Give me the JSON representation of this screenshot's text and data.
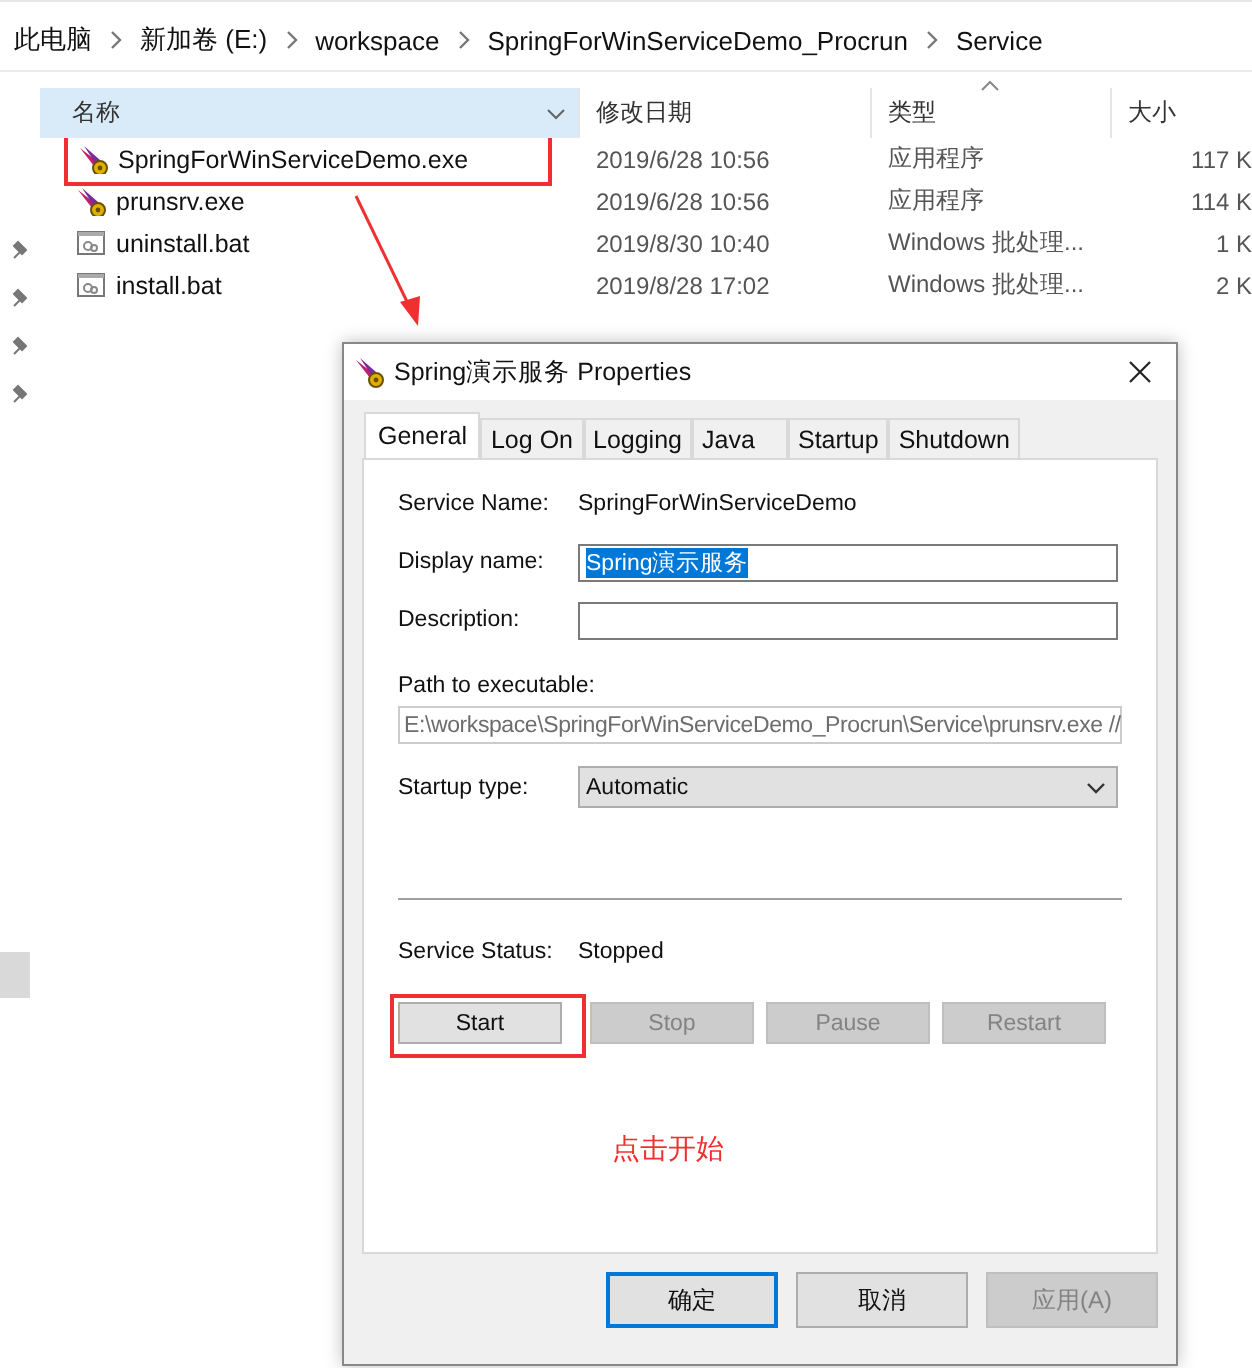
{
  "breadcrumb": [
    "此电脑",
    "新加卷 (E:)",
    "workspace",
    "SpringForWinServiceDemo_Procrun",
    "Service"
  ],
  "file_list": {
    "columns": [
      {
        "label": "名称",
        "selected": true
      },
      {
        "label": "修改日期",
        "selected": false
      },
      {
        "label": "类型",
        "selected": false
      },
      {
        "label": "大小",
        "selected": false
      }
    ],
    "rows": [
      {
        "kind": "exe",
        "name": "SpringForWinServiceDemo.exe",
        "date": "2019/6/28 10:56",
        "type": "应用程序",
        "size": "117 K",
        "highlighted": true
      },
      {
        "kind": "exe",
        "name": "prunsrv.exe",
        "date": "2019/6/28 10:56",
        "type": "应用程序",
        "size": "114 K",
        "highlighted": false
      },
      {
        "kind": "bat",
        "name": "uninstall.bat",
        "date": "2019/8/30 10:40",
        "type": "Windows 批处理...",
        "size": "1 K",
        "highlighted": false
      },
      {
        "kind": "bat",
        "name": "install.bat",
        "date": "2019/8/28 17:02",
        "type": "Windows 批处理...",
        "size": "2 K",
        "highlighted": false
      }
    ]
  },
  "dialog": {
    "title": "Spring演示服务 Properties",
    "tabs": [
      {
        "label": "General",
        "selected": true
      },
      {
        "label": "Log On",
        "selected": false
      },
      {
        "label": "Logging",
        "selected": false
      },
      {
        "label": "Java",
        "selected": false
      },
      {
        "label": "Startup",
        "selected": false
      },
      {
        "label": "Shutdown",
        "selected": false
      }
    ],
    "service_name": {
      "label": "Service Name:",
      "value": "SpringForWinServiceDemo"
    },
    "display_name": {
      "label": "Display name:",
      "value": "Spring演示服务",
      "text_selected": true
    },
    "description": {
      "label": "Description:"
    },
    "path": {
      "label": "Path to executable:",
      "value": "E:\\workspace\\SpringForWinServiceDemo_Procrun\\Service\\prunsrv.exe //",
      "disabled": true
    },
    "startup_type": {
      "label": "Startup type:",
      "value": "Automatic"
    },
    "status": {
      "label": "Service Status:",
      "value": "Stopped"
    },
    "service_buttons": [
      {
        "label": "Start",
        "disabled": false,
        "highlighted": true
      },
      {
        "label": "Stop",
        "disabled": true,
        "highlighted": false
      },
      {
        "label": "Pause",
        "disabled": true,
        "highlighted": false
      },
      {
        "label": "Restart",
        "disabled": true,
        "highlighted": false
      }
    ],
    "annotation": "点击开始",
    "footer_buttons": [
      {
        "label": "确定",
        "default": true,
        "disabled": false
      },
      {
        "label": "取消",
        "default": false,
        "disabled": false
      },
      {
        "label": "应用(A)",
        "default": false,
        "disabled": true
      }
    ]
  }
}
